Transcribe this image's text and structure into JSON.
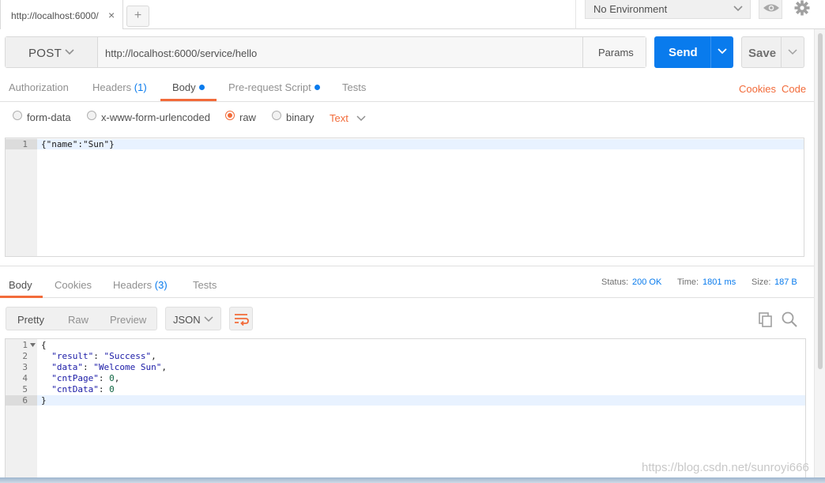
{
  "tab": {
    "title": "http://localhost:6000/",
    "close": "×",
    "new": "+"
  },
  "environment": {
    "selected": "No Environment"
  },
  "request": {
    "method": "POST",
    "url": "http://localhost:6000/service/hello",
    "params_label": "Params",
    "send_label": "Send",
    "save_label": "Save"
  },
  "request_tabs": {
    "authorization": "Authorization",
    "headers": "Headers",
    "headers_count": "(1)",
    "body": "Body",
    "prerequest": "Pre-request Script",
    "tests": "Tests",
    "cookies": "Cookies",
    "code": "Code"
  },
  "body_types": {
    "form_data": "form-data",
    "urlencoded": "x-www-form-urlencoded",
    "raw": "raw",
    "binary": "binary",
    "text_type": "Text",
    "selected": "raw"
  },
  "request_body": {
    "lines": [
      "{\"name\":\"Sun\"}"
    ],
    "line_numbers": [
      "1"
    ]
  },
  "response_tabs": {
    "body": "Body",
    "cookies": "Cookies",
    "headers": "Headers",
    "headers_count": "(3)",
    "tests": "Tests"
  },
  "response_meta": {
    "status_label": "Status:",
    "status_value": "200 OK",
    "time_label": "Time:",
    "time_value": "1801 ms",
    "size_label": "Size:",
    "size_value": "187 B"
  },
  "response_view": {
    "pretty": "Pretty",
    "raw": "Raw",
    "preview": "Preview",
    "format": "JSON"
  },
  "response_body": {
    "line_numbers": [
      "1",
      "2",
      "3",
      "4",
      "5",
      "6"
    ],
    "line1": "{",
    "result_key": "\"result\"",
    "result_value": "\"Success\"",
    "data_key": "\"data\"",
    "data_value": "\"Welcome Sun\"",
    "cntpage_key": "\"cntPage\"",
    "cntpage_value": "0",
    "cntdata_key": "\"cntData\"",
    "cntdata_value": "0",
    "line6": "}"
  },
  "watermark": "https://blog.csdn.net/sunroyi666",
  "colors": {
    "accent": "#f26b3a",
    "primary": "#097bed"
  }
}
